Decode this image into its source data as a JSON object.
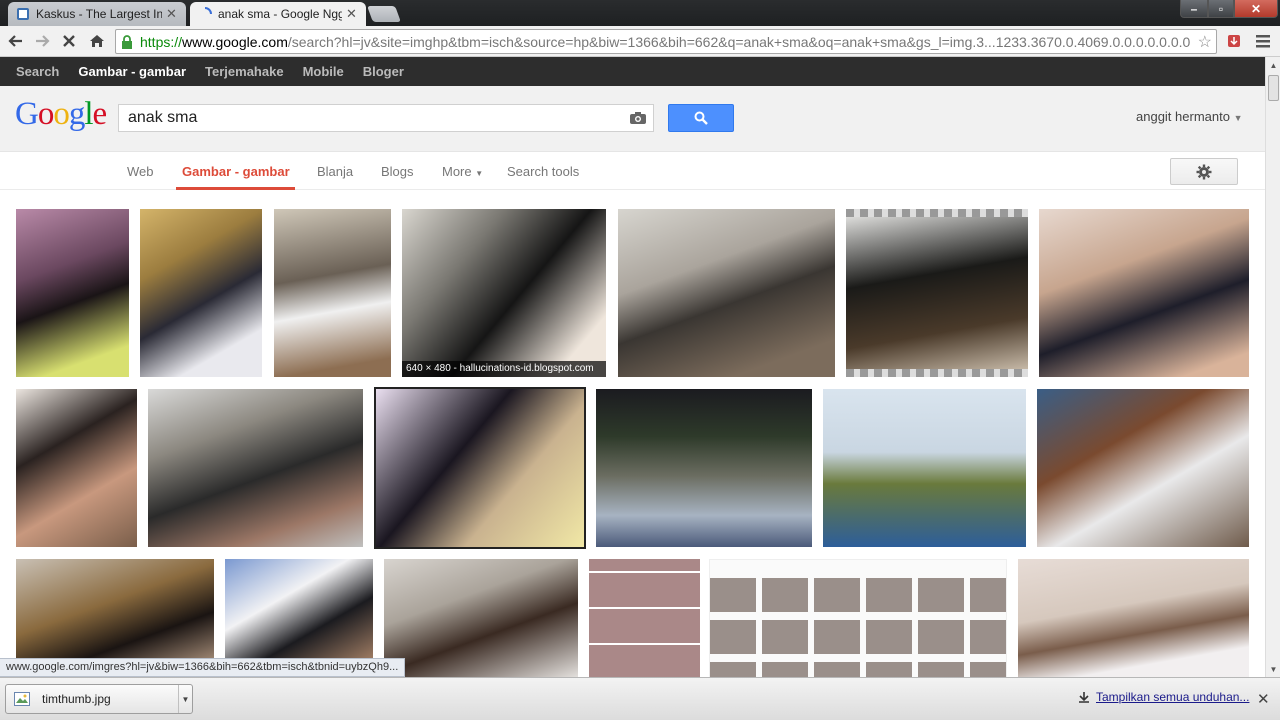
{
  "browser": {
    "tabs": [
      {
        "title": "Kaskus - The Largest Indo",
        "active": false
      },
      {
        "title": "anak sma - Google Nggoli",
        "active": true
      }
    ],
    "url_scheme": "https://",
    "url_host": "www.google.com",
    "url_rest": "/search?hl=jv&site=imghp&tbm=isch&source=hp&biw=1366&bih=662&q=anak+sma&oq=anak+sma&gs_l=img.3...1233.3670.0.4069.0.0.0.0.0.0.0"
  },
  "gbar": {
    "items": [
      "Search",
      "Gambar - gambar",
      "Terjemahake",
      "Mobile",
      "Bloger"
    ],
    "active_index": 1
  },
  "search": {
    "logo": "Google",
    "query": "anak sma",
    "user": "anggit hermanto"
  },
  "search_tabs": [
    "Web",
    "Gambar - gambar",
    "Blanja",
    "Blogs",
    "More",
    "Search tools"
  ],
  "thumbnails": {
    "row1_4_info": "640 × 480 - hallucinations-id.blogspot.com"
  },
  "status_url": "www.google.com/imgres?hl=jv&biw=1366&bih=662&tbm=isch&tbnid=uybzQh9...",
  "downloads": {
    "file": "timthumb.jpg",
    "show_all": "Tampilkan semua unduhan..."
  },
  "colors": {
    "accent_red": "#dd4b39",
    "search_blue": "#4d90fe",
    "gbar_bg": "#2d2d2d"
  }
}
